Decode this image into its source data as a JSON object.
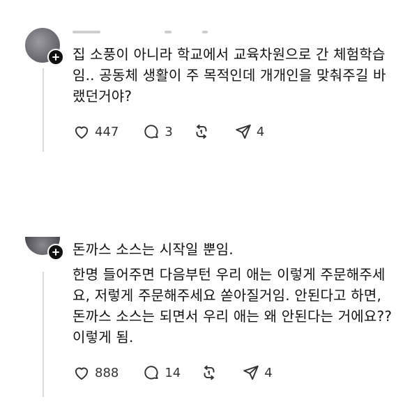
{
  "posts": [
    {
      "text_lines": [
        "집 소풍이 아니라 학교에서 교육차원으로 간 체험학습",
        "임.. 공동체 생활이 주 목적인데 개개인을 맞춰주길 바",
        "랬던거야?"
      ],
      "likes": "447",
      "comments": "3",
      "shares": "4"
    },
    {
      "text_lines": [
        "돈까스 소스는 시작일 뿐임.",
        "한명 들어주면 다음부턴 우리 애는 이렇게 주문해주세",
        "요, 저렇게 주문해주세요 쏟아질거임. 안된다고 하면,",
        "돈까스 소스는 되면서 우리 애는 왜 안된다는 거에요??",
        "이렇게 됨."
      ],
      "likes": "888",
      "comments": "14",
      "shares": "4"
    }
  ],
  "colors": {
    "text": "#111111",
    "icon": "#333333",
    "thread": "#d9d9d9",
    "badge": "#111111"
  },
  "icons": [
    "heart-icon",
    "comment-icon",
    "repost-icon",
    "share-icon",
    "plus-icon"
  ]
}
